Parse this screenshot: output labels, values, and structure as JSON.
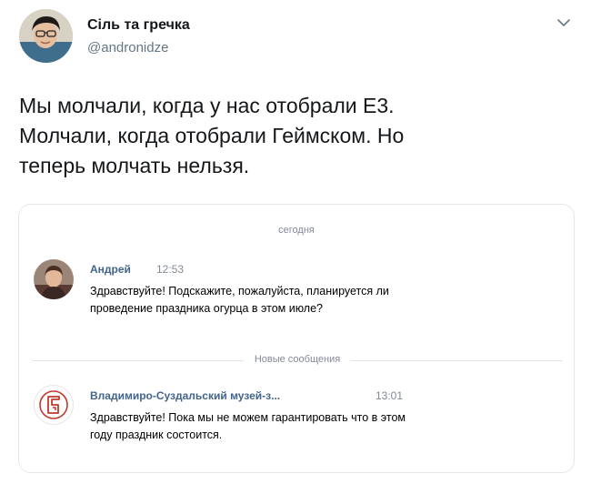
{
  "tweet": {
    "display_name": "Сіль та гречка",
    "handle": "@andronidze",
    "text_lines": [
      "Мы молчали, когда у нас отобрали Е3.",
      "Молчали, когда отобрали Геймском. Но",
      "теперь молчать нельзя."
    ]
  },
  "chat": {
    "date_separator": "сегодня",
    "new_messages_separator": "Новые сообщения",
    "messages": [
      {
        "sender": "Андрей",
        "time": "12:53",
        "lines": [
          "Здравствуйте! Подскажите, пожалуйста, планируется ли",
          "проведение праздника огурца в этом июле?"
        ]
      },
      {
        "sender": "Владимиро-Суздальский музей-з...",
        "time": "13:01",
        "lines": [
          "Здравствуйте! Пока мы не можем гарантировать что в этом",
          "году праздник состоится."
        ]
      }
    ]
  },
  "colors": {
    "sender": "#42648b",
    "muted": "#828a99",
    "handle": "#657786",
    "museum_logo": "#c0392b"
  }
}
